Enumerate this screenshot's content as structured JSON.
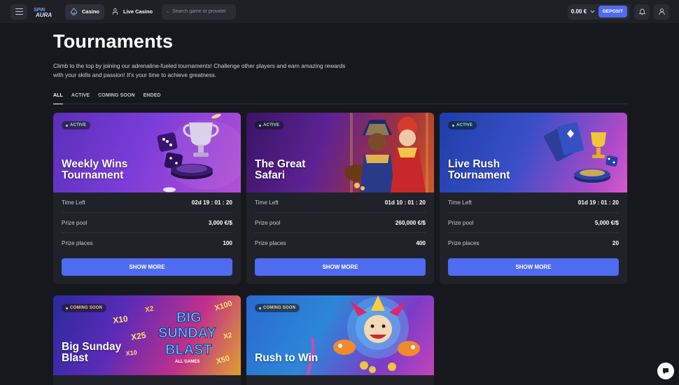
{
  "header": {
    "nav": [
      {
        "label": "Casino",
        "icon": "spade-icon"
      },
      {
        "label": "Live Casino",
        "icon": "dealer-icon"
      }
    ],
    "search_placeholder": "Search game or provider",
    "balance": "0.00 €",
    "deposit_label": "DEPOSIT",
    "accent_color": "#4f6bf0"
  },
  "page": {
    "title": "Tournaments",
    "description": "Climb to the top by joining our adrenaline-fueled tournaments! Challenge other players and earn amazing rewards with your skills and passion! It's your time to achieve greatness."
  },
  "tabs": [
    "ALL",
    "ACTIVE",
    "COMING SOON",
    "ENDED"
  ],
  "labels": {
    "time_left": "Time Left",
    "prize_pool": "Prize pool",
    "prize_places": "Prize places",
    "show_more": "SHOW MORE"
  },
  "tournaments": [
    {
      "status": "ACTIVE",
      "title_line1": "Weekly Wins",
      "title_line2": "Tournament",
      "time_left": "02d  19 : 01 : 20",
      "prize_pool": "3,000 €/$",
      "prize_places": "100"
    },
    {
      "status": "ACTIVE",
      "title_line1": "The Great",
      "title_line2": "Safari",
      "time_left": "01d  10 : 01 : 20",
      "prize_pool": "260,000 €/$",
      "prize_places": "400"
    },
    {
      "status": "ACTIVE",
      "title_line1": "Live Rush",
      "title_line2": "Tournament",
      "time_left": "01d  19 : 01 : 20",
      "prize_pool": "5,000 €/$",
      "prize_places": "20"
    },
    {
      "status": "COMING SOON",
      "title_line1": "Big Sunday",
      "title_line2": "Blast",
      "art_text": [
        "BIG",
        "SUNDAY",
        "BLAST",
        "ALL GAMES"
      ],
      "multipliers": [
        "X2",
        "X10",
        "X25",
        "X100",
        "X2",
        "X50",
        "X10"
      ]
    },
    {
      "status": "COMING SOON",
      "title_line1": "Rush to Win",
      "title_line2": ""
    }
  ]
}
